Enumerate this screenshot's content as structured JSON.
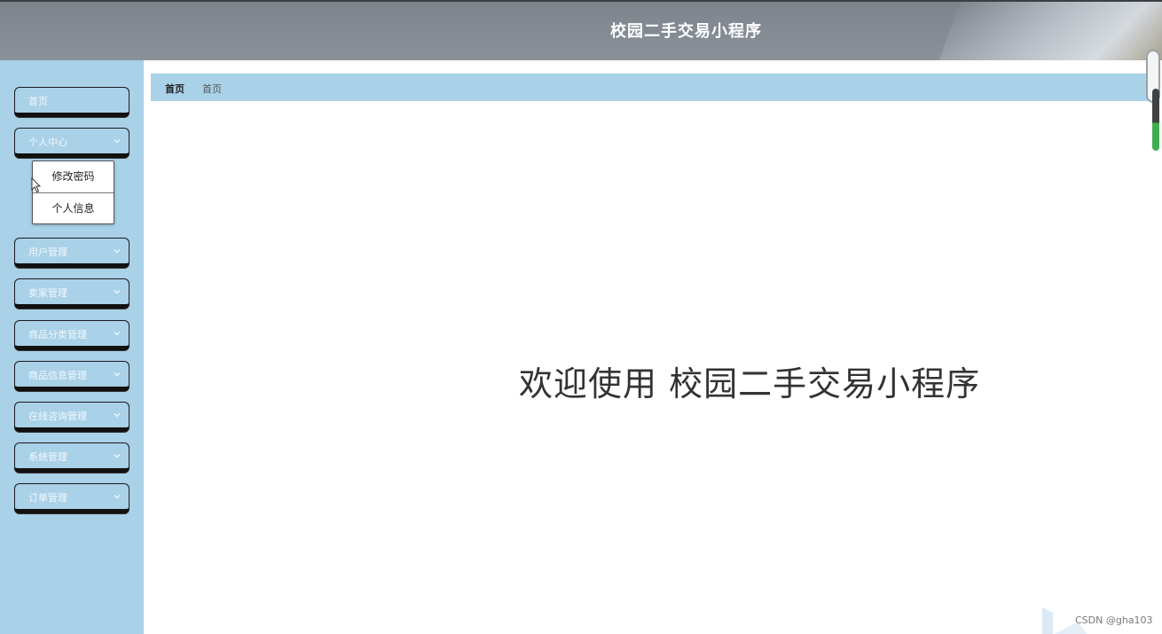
{
  "header": {
    "title": "校园二手交易小程序"
  },
  "sidebar": {
    "items": [
      {
        "label": "首页",
        "has_chevron": false
      },
      {
        "label": "个人中心",
        "has_chevron": true
      },
      {
        "label": "用户管理",
        "has_chevron": true
      },
      {
        "label": "卖家管理",
        "has_chevron": true
      },
      {
        "label": "商品分类管理",
        "has_chevron": true
      },
      {
        "label": "商品信息管理",
        "has_chevron": true
      },
      {
        "label": "在线咨询管理",
        "has_chevron": true
      },
      {
        "label": "系统管理",
        "has_chevron": true
      },
      {
        "label": "订单管理",
        "has_chevron": true
      }
    ],
    "submenu": {
      "items": [
        {
          "label": "修改密码"
        },
        {
          "label": "个人信息"
        }
      ]
    }
  },
  "breadcrumb": {
    "main": "首页",
    "sub": "首页"
  },
  "main": {
    "welcome": "欢迎使用 校园二手交易小程序"
  },
  "watermark": {
    "text": "CSDN @gha103"
  },
  "colors": {
    "sidebar_bg": "#a9d1e8",
    "header_bg": "#858c94",
    "menu_border": "#111111",
    "breadcrumb_bg": "#a9d1e8"
  },
  "icons": {
    "chevron": "chevron-down-icon",
    "cursor": "mouse-cursor-icon"
  }
}
